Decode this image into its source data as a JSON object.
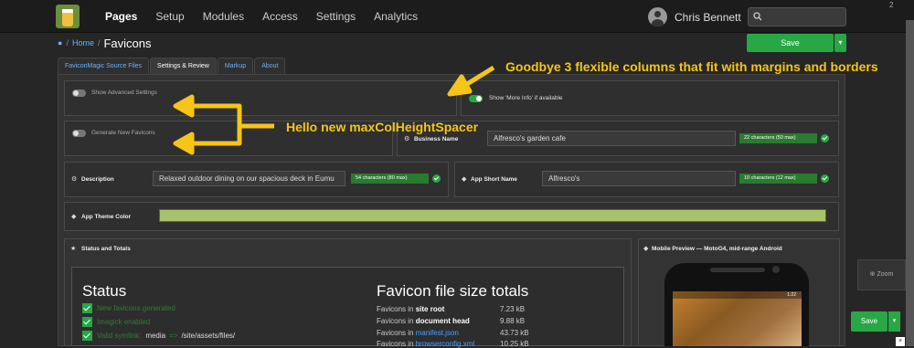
{
  "topbar": {
    "nav": [
      "Pages",
      "Setup",
      "Modules",
      "Access",
      "Settings",
      "Analytics"
    ],
    "user_name": "Chris Bennett",
    "page_indicator": "2"
  },
  "breadcrumb": {
    "home": "Home",
    "title": "Favicons"
  },
  "header": {
    "save_label": "Save",
    "dropdown": "▾"
  },
  "tabs": [
    "FaviconMagic Source Files",
    "Settings & Review",
    "Markup",
    "About"
  ],
  "form": {
    "show_advanced": "Show Advanced Settings",
    "show_more_info": "Show 'More Info' if available",
    "generate_new": "Generate New Favicons",
    "business_name_label": "Business Name",
    "business_name_value": "Alfresco's garden cafe",
    "business_name_count": "22 characters (50 max)",
    "description_label": "Description",
    "description_value": "Relaxed outdoor dining on our spacious deck in Eumu",
    "description_count": "54 characters (80 max)",
    "short_name_label": "App Short Name",
    "short_name_value": "Alfresco's",
    "short_name_count": "10 characters (12 max)",
    "theme_color_label": "App Theme Color",
    "theme_color": "#a6c26b",
    "more_info_on": true
  },
  "status": {
    "section_title": "Status and Totals",
    "heading": "Status",
    "items": [
      {
        "text": "New favicons generated"
      },
      {
        "text": "Imagick enabled"
      },
      {
        "text": "Valid symlink:",
        "value": "media",
        "arrow": "=>",
        "target": "/site/assets/files/"
      }
    ]
  },
  "filesizes": {
    "heading": "Favicon file size totals",
    "rows": [
      {
        "prefix": "Favicons in",
        "loc": "site root",
        "link": false,
        "size": "7.23 kB"
      },
      {
        "prefix": "Favicons in",
        "loc": "document head",
        "link": false,
        "size": "9.88 kB"
      },
      {
        "prefix": "Favicons in",
        "loc": "manifest.json",
        "link": true,
        "size": "43.73 kB"
      },
      {
        "prefix": "Favicons in",
        "loc": "browserconfig.xml",
        "link": true,
        "size": "10.25 kB"
      }
    ]
  },
  "mobile": {
    "title": "Mobile Preview — MotoG4, mid-range Android",
    "time": "1:22"
  },
  "side": {
    "zoom": "Zoom",
    "save": "Save",
    "dropdown": "▾",
    "ad_close": "×"
  },
  "annotations": {
    "top": "Goodbye 3 flexible columns that fit with margins and borders",
    "middle": "Hello new maxColHeightSpacer"
  },
  "colors": {
    "accent": "#28a745",
    "annotation": "#f5c518",
    "link": "#4aa0ff"
  }
}
